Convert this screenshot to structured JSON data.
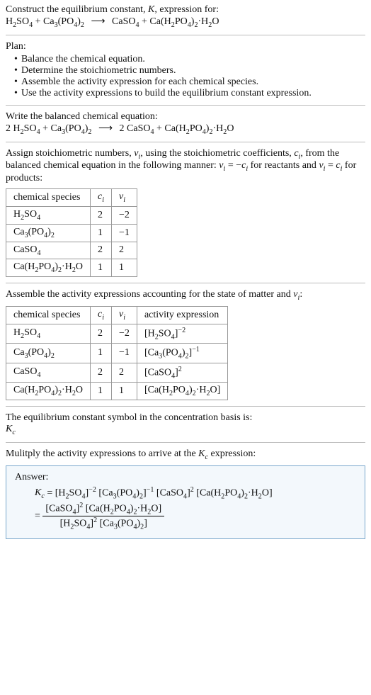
{
  "header": {
    "prompt_line": "Construct the equilibrium constant, K, expression for:",
    "equation_html": "H<sub>2</sub>SO<sub>4</sub> + Ca<sub>3</sub>(PO<sub>4</sub>)<sub>2</sub> <span class='arrow'>⟶</span> CaSO<sub>4</sub> + Ca(H<sub>2</sub>PO<sub>4</sub>)<sub>2</sub>·H<sub>2</sub>O"
  },
  "plan": {
    "heading": "Plan:",
    "items": [
      "Balance the chemical equation.",
      "Determine the stoichiometric numbers.",
      "Assemble the activity expression for each chemical species.",
      "Use the activity expressions to build the equilibrium constant expression."
    ]
  },
  "balanced": {
    "heading": "Write the balanced chemical equation:",
    "equation_html": "2 H<sub>2</sub>SO<sub>4</sub> + Ca<sub>3</sub>(PO<sub>4</sub>)<sub>2</sub> <span class='arrow'>⟶</span> 2 CaSO<sub>4</sub> + Ca(H<sub>2</sub>PO<sub>4</sub>)<sub>2</sub>·H<sub>2</sub>O"
  },
  "assign": {
    "text_html": "Assign stoichiometric numbers, <span class='italic'>ν<sub>i</sub></span>, using the stoichiometric coefficients, <span class='italic'>c<sub>i</sub></span>, from the balanced chemical equation in the following manner: <span class='italic'>ν<sub>i</sub></span> = −<span class='italic'>c<sub>i</sub></span> for reactants and <span class='italic'>ν<sub>i</sub></span> = <span class='italic'>c<sub>i</sub></span> for products:",
    "headers": {
      "species": "chemical species",
      "ci_html": "<span class='italic'>c<sub>i</sub></span>",
      "vi_html": "<span class='italic'>ν<sub>i</sub></span>"
    },
    "rows": [
      {
        "species_html": "H<sub>2</sub>SO<sub>4</sub>",
        "ci": "2",
        "vi": "−2"
      },
      {
        "species_html": "Ca<sub>3</sub>(PO<sub>4</sub>)<sub>2</sub>",
        "ci": "1",
        "vi": "−1"
      },
      {
        "species_html": "CaSO<sub>4</sub>",
        "ci": "2",
        "vi": "2"
      },
      {
        "species_html": "Ca(H<sub>2</sub>PO<sub>4</sub>)<sub>2</sub>·H<sub>2</sub>O",
        "ci": "1",
        "vi": "1"
      }
    ]
  },
  "activity": {
    "text_html": "Assemble the activity expressions accounting for the state of matter and <span class='italic'>ν<sub>i</sub></span>:",
    "headers": {
      "species": "chemical species",
      "ci_html": "<span class='italic'>c<sub>i</sub></span>",
      "vi_html": "<span class='italic'>ν<sub>i</sub></span>",
      "act": "activity expression"
    },
    "rows": [
      {
        "species_html": "H<sub>2</sub>SO<sub>4</sub>",
        "ci": "2",
        "vi": "−2",
        "act_html": "[H<sub>2</sub>SO<sub>4</sub>]<sup>−2</sup>"
      },
      {
        "species_html": "Ca<sub>3</sub>(PO<sub>4</sub>)<sub>2</sub>",
        "ci": "1",
        "vi": "−1",
        "act_html": "[Ca<sub>3</sub>(PO<sub>4</sub>)<sub>2</sub>]<sup>−1</sup>"
      },
      {
        "species_html": "CaSO<sub>4</sub>",
        "ci": "2",
        "vi": "2",
        "act_html": "[CaSO<sub>4</sub>]<sup>2</sup>"
      },
      {
        "species_html": "Ca(H<sub>2</sub>PO<sub>4</sub>)<sub>2</sub>·H<sub>2</sub>O",
        "ci": "1",
        "vi": "1",
        "act_html": "[Ca(H<sub>2</sub>PO<sub>4</sub>)<sub>2</sub>·H<sub>2</sub>O]"
      }
    ]
  },
  "symbol": {
    "line1": "The equilibrium constant symbol in the concentration basis is:",
    "line2_html": "<span class='italic'>K<sub>c</sub></span>"
  },
  "multiply": {
    "text_html": "Mulitply the activity expressions to arrive at the <span class='italic'>K<sub>c</sub></span> expression:"
  },
  "answer": {
    "label": "Answer:",
    "line1_html": "<span class='italic'>K<sub>c</sub></span> = [H<sub>2</sub>SO<sub>4</sub>]<sup>−2</sup> [Ca<sub>3</sub>(PO<sub>4</sub>)<sub>2</sub>]<sup>−1</sup> [CaSO<sub>4</sub>]<sup>2</sup> [Ca(H<sub>2</sub>PO<sub>4</sub>)<sub>2</sub>·H<sub>2</sub>O]",
    "frac_num_html": "[CaSO<sub>4</sub>]<sup>2</sup> [Ca(H<sub>2</sub>PO<sub>4</sub>)<sub>2</sub>·H<sub>2</sub>O]",
    "frac_den_html": "[H<sub>2</sub>SO<sub>4</sub>]<sup>2</sup> [Ca<sub>3</sub>(PO<sub>4</sub>)<sub>2</sub>]",
    "eq_prefix": "= "
  }
}
